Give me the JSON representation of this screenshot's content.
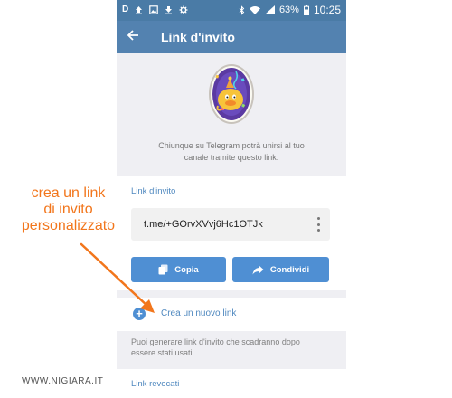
{
  "status_bar": {
    "left_icons": [
      "d-icon",
      "upload-icon",
      "image-icon",
      "download-icon",
      "settings-icon"
    ],
    "battery_percent": "63%",
    "time": "10:25"
  },
  "app_bar": {
    "back_icon": "arrow-left-icon",
    "title": "Link d'invito"
  },
  "hero": {
    "description_line1": "Chiunque su Telegram potrà unirsi al tuo",
    "description_line2": "canale tramite questo link."
  },
  "invite_section": {
    "title": "Link d'invito",
    "link": "t.me/+GOrvXVvj6Hc1OTJk",
    "copy_label": "Copia",
    "share_label": "Condividi"
  },
  "new_link": {
    "label": "Crea un nuovo link"
  },
  "hint": {
    "line1": "Puoi generare link d'invito che scadranno dopo",
    "line2": "essere stati usati."
  },
  "revoked": {
    "title": "Link revocati"
  },
  "annotation": {
    "line1": "crea un link",
    "line2": "di invito",
    "line3": "personalizzato"
  },
  "watermark": "WWW.NIGIARA.IT",
  "colors": {
    "status_bar": "#4a7ba6",
    "app_bar": "#5382b0",
    "accent": "#4f88bf",
    "button": "#4f8fd3",
    "annotation": "#f2761c"
  }
}
